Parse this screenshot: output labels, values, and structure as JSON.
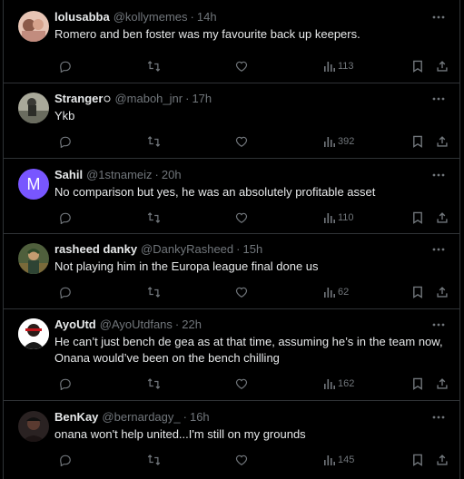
{
  "colors": {
    "background": "#000000",
    "text": "#e7e9ea",
    "muted": "#71767b",
    "divider": "#2f3336",
    "avatar_letter_bg": "#7856ff"
  },
  "icons": {
    "more": "more-icon",
    "reply": "reply-icon",
    "retweet": "retweet-icon",
    "like": "like-icon",
    "views": "views-icon",
    "bookmark": "bookmark-icon",
    "share": "share-icon"
  },
  "tweets": [
    {
      "name": "lolusabba",
      "handle": "@kollymemes",
      "separator": "·",
      "time": "14h",
      "text": "Romero and ben foster was my favourite back up keepers.",
      "views": "113"
    },
    {
      "name": "Stranger",
      "handle": "@maboh_jnr",
      "separator": "·",
      "time": "17h",
      "text": "Ykb",
      "views": "392"
    },
    {
      "name": "Sahil",
      "handle": "@1stnameiz",
      "separator": "·",
      "time": "20h",
      "avatar_letter": "M",
      "text": "No comparison but yes, he was an absolutely profitable asset",
      "views": "110"
    },
    {
      "name": "rasheed danky",
      "handle": "@DankyRasheed",
      "separator": "·",
      "time": "15h",
      "text": "Not playing him in the Europa league final done us",
      "views": "62"
    },
    {
      "name": "AyoUtd",
      "handle": "@AyoUtdfans",
      "separator": "·",
      "time": "22h",
      "text": "He can’t just bench de gea as at that time, assuming he’s in the team now, Onana would’ve been on the bench chilling",
      "views": "162"
    },
    {
      "name": "BenKay",
      "handle": "@bernardagy_",
      "separator": "·",
      "time": "16h",
      "text": "onana won't help united...I'm still on my grounds",
      "views": "145"
    }
  ]
}
